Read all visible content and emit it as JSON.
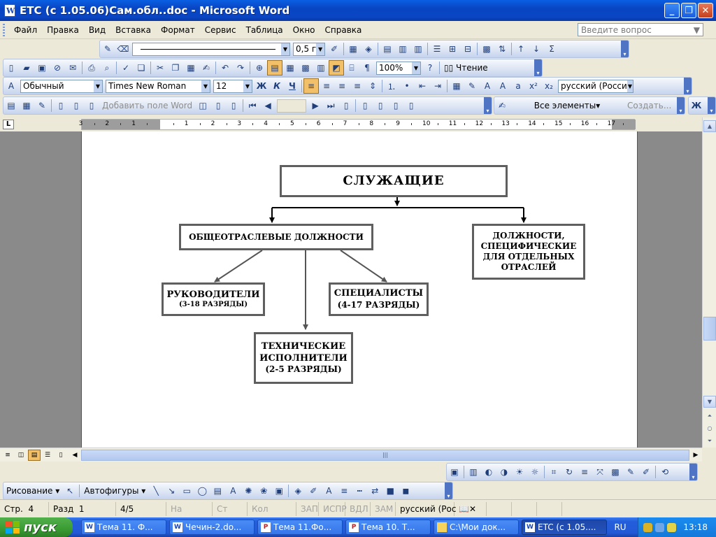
{
  "window": {
    "title": "ETC (c 1.05.06)Сам.обл..doc - Microsoft Word",
    "icon": "word-doc-icon"
  },
  "menu": {
    "items": [
      "Файл",
      "Правка",
      "Вид",
      "Вставка",
      "Формат",
      "Сервис",
      "Таблица",
      "Окно",
      "Справка"
    ],
    "help_placeholder": "Введите вопрос"
  },
  "toolbars": {
    "drawing_line_width": "0,5 г",
    "standard_zoom": "100%",
    "standard_read": "Чтение",
    "format_style": "Обычный",
    "format_font": "Times New Roman",
    "format_size": "12",
    "format_bold": "Ж",
    "format_italic": "К",
    "format_underline": "Ч",
    "format_language": "русский (Росси",
    "forms_add_field": "Добавить поле Word",
    "forms_all_elements": "Все элементы",
    "forms_create": "Создать...",
    "extra_bold": "Ж"
  },
  "ruler": {
    "marks": [
      "3",
      "2",
      "1",
      "1",
      "2",
      "3",
      "4",
      "5",
      "6",
      "7",
      "8",
      "9",
      "10",
      "11",
      "12",
      "13",
      "14",
      "15",
      "16",
      "17"
    ]
  },
  "diagram": {
    "root": "СЛУЖАЩИЕ",
    "left": "ОБЩЕОТРАСЛЕВЫЕ ДОЛЖНОСТИ",
    "right": [
      "ДОЛЖНОСТИ,",
      "СПЕЦИФИЧЕСКИЕ",
      "ДЛЯ ОТДЕЛЬНЫХ",
      "ОТРАСЛЕЙ"
    ],
    "managers": {
      "title": "РУКОВОДИТЕЛИ",
      "sub": "(3-18 РАЗРЯДЫ)"
    },
    "specialists": {
      "title": "СПЕЦИАЛИСТЫ",
      "sub": "(4-17 РАЗРЯДЫ)"
    },
    "technicians": {
      "lines": [
        "ТЕХНИЧЕСКИЕ",
        "ИСПОЛНИТЕЛИ"
      ],
      "sub": "(2-5 РАЗРЯДЫ)"
    }
  },
  "drawing": {
    "draw_label": "Рисование",
    "autoshapes_label": "Автофигуры"
  },
  "status": {
    "page": "Стр.",
    "page_num": "4",
    "section": "Разд",
    "section_num": "1",
    "pages": "4/5",
    "at": "На",
    "line": "Ст",
    "col": "Кол",
    "rec": "ЗАП",
    "trk": "ИСПР",
    "ext": "ВДЛ",
    "ovr": "ЗАМ",
    "language": "русский (Рос"
  },
  "taskbar": {
    "start": "пуск",
    "tasks": [
      "Тема 11. Ф...",
      "Чечин-2.do...",
      "Тема 11.Фо...",
      "Тема 10. Т...",
      "C:\\Мои док...",
      "ETC (c 1.05...."
    ],
    "lang": "RU",
    "clock": "13:18"
  }
}
